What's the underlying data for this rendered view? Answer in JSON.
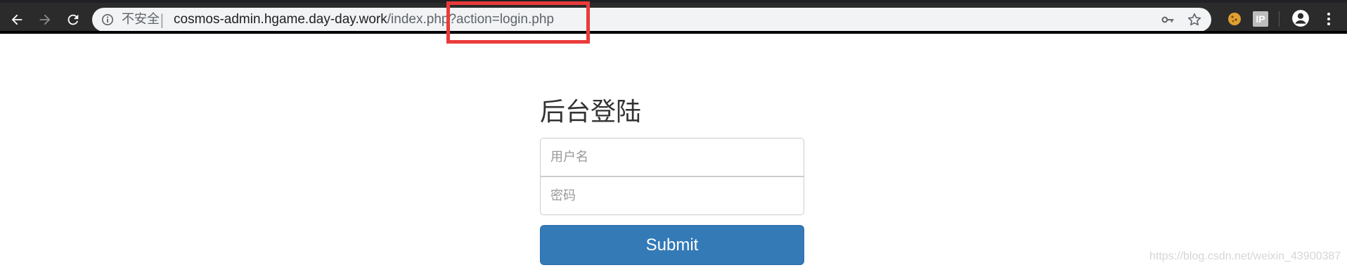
{
  "browser": {
    "security_label": "不安全",
    "separator": "|",
    "url_host": "cosmos-admin.hgame.day-day.work",
    "url_path": "/index.php?action=login.php",
    "icons": {
      "back": "arrow-left-icon",
      "forward": "arrow-right-icon",
      "reload": "reload-icon",
      "info": "info-icon",
      "key": "key-icon",
      "star": "star-icon",
      "extension1": "cookie-icon",
      "extension2": "ip-icon",
      "profile": "account-icon",
      "menu": "more-vert-icon"
    },
    "ext2_label": "IP"
  },
  "login": {
    "heading": "后台登陆",
    "username_placeholder": "用户名",
    "password_placeholder": "密码",
    "submit_label": "Submit"
  },
  "watermark": "https://blog.csdn.net/weixin_43900387",
  "colors": {
    "highlight": "#ea3b3b",
    "button": "#337ab7"
  }
}
